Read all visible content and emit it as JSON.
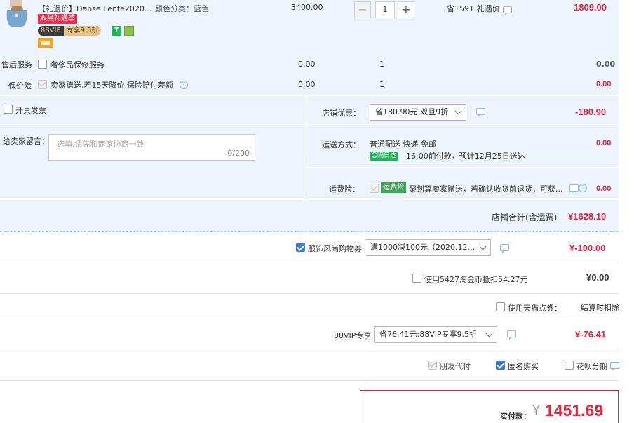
{
  "product": {
    "title": "【礼遇价】Danse Lente2020...",
    "spec": "颜色分类：蓝色",
    "price": "3400.00",
    "qty": "1",
    "saving": "省1591:礼遇价",
    "subtotal": "1809.00",
    "badge_festival": "双旦礼遇季",
    "badge_vip": "88VIP",
    "badge_vip_discount": "专享9.5折",
    "badge_seven": "7"
  },
  "services": [
    {
      "label": "售后服务",
      "name": "奢侈品保修服务",
      "price": "0.00",
      "qty": "1",
      "total": "0.00"
    },
    {
      "label": "保价险",
      "name": "卖家赠送,若15天降价,保险赔付差额",
      "price": "0.00",
      "qty": "1",
      "total": "0.00"
    }
  ],
  "invoice": {
    "label": "开具发票"
  },
  "message": {
    "label": "给卖家留言：",
    "placeholder": "选填,请先和商家协商一致",
    "count": "0/200"
  },
  "shop_discount": {
    "label": "店铺优惠：",
    "value": "省180.90元:双旦9折",
    "amount": "-180.90"
  },
  "shipping": {
    "label": "运送方式：",
    "method": "普通配送 快递 免邮",
    "badge": "隔日达",
    "eta": "16:00前付款，预计12月25日送达",
    "amount": "0.00"
  },
  "freight_insurance": {
    "label": "运费险：",
    "badge": "运费险",
    "text": "聚划算卖家赠送，若确认收货前退货，可获...",
    "amount": "0.00"
  },
  "shop_total": {
    "label": "店铺合计(含运费)",
    "amount": "¥1628.10"
  },
  "coupon": {
    "label": "服饰风尚购物券",
    "value": "满1000减100元（2020.12...",
    "amount": "¥-100.00"
  },
  "taojinbi": {
    "label": "使用5427淘金币抵扣54.27元",
    "amount": "¥0.00"
  },
  "tmall_points": {
    "label": "使用天猫点券：",
    "note": "结算时扣除"
  },
  "vip88": {
    "label": "88VIP专享",
    "value": "省76.41元:88VIP专享9.5折",
    "amount": "¥-76.41"
  },
  "options": {
    "friend_pay": "朋友代付",
    "anonymous": "匿名购买",
    "huabei": "花呗分期"
  },
  "payment": {
    "label": "实付款：",
    "currency": "¥",
    "amount": "1451.69"
  },
  "colors": {
    "accent_red": "#e4263f",
    "blue_bg": "#edf4fe"
  }
}
